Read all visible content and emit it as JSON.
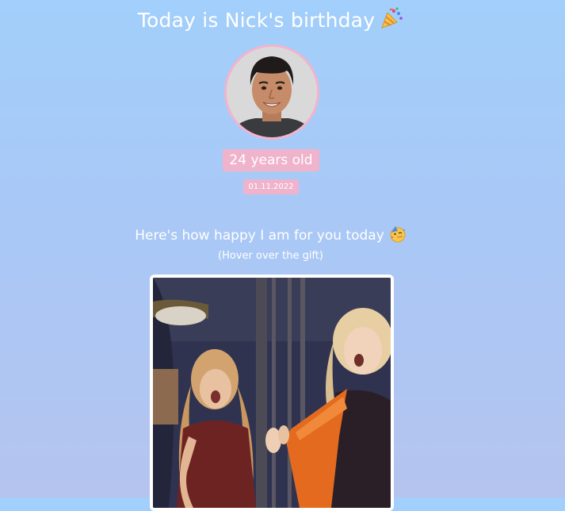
{
  "header": {
    "title": "Today is Nick's birthday",
    "title_icon": "party-popper-icon"
  },
  "profile": {
    "age_label": "24 years old",
    "date": "01.11.2022"
  },
  "message": {
    "text": "Here's how happy I am for you today",
    "icon": "partying-face-icon",
    "hint": "(Hover over the gift)"
  },
  "colors": {
    "background_top": "#a2cffb",
    "background_bottom": "#b5c4ef",
    "badge": "#f0b3cc",
    "avatar_border": "#f2b3cd",
    "text": "#ffffff"
  }
}
